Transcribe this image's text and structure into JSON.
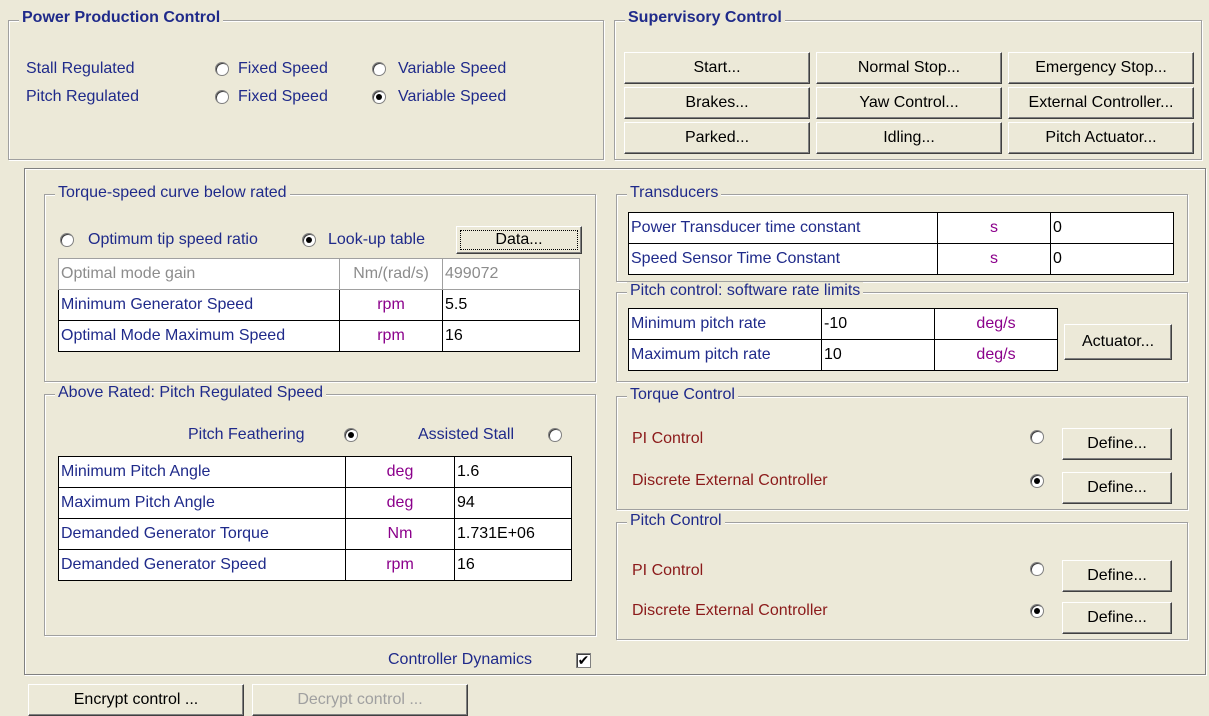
{
  "power_production": {
    "title": "Power Production Control",
    "rows": [
      {
        "label": "Stall Regulated",
        "opt1": "Fixed Speed",
        "opt2": "Variable Speed",
        "selected": "none"
      },
      {
        "label": "Pitch Regulated",
        "opt1": "Fixed Speed",
        "opt2": "Variable Speed",
        "selected": "opt2"
      }
    ]
  },
  "supervisory": {
    "title": "Supervisory Control",
    "buttons": [
      "Start...",
      "Normal Stop...",
      "Emergency Stop...",
      "Brakes...",
      "Yaw Control...",
      "External Controller...",
      "Parked...",
      "Idling...",
      "Pitch Actuator..."
    ]
  },
  "torque_speed": {
    "title": "Torque-speed curve below rated",
    "opt_tsr": "Optimum tip speed ratio",
    "opt_lookup": "Look-up table",
    "selected": "lookup",
    "data_button": "Data...",
    "rows": [
      {
        "name": "Optimal mode gain",
        "unit": "Nm/(rad/s)",
        "value": "499072",
        "disabled": true
      },
      {
        "name": "Minimum Generator Speed",
        "unit": "rpm",
        "value": "5.5"
      },
      {
        "name": "Optimal Mode Maximum Speed",
        "unit": "rpm",
        "value": "16"
      }
    ]
  },
  "above_rated": {
    "title": "Above Rated: Pitch Regulated Speed",
    "opt_feather": "Pitch Feathering",
    "opt_stall": "Assisted Stall",
    "selected": "feather",
    "rows": [
      {
        "name": "Minimum Pitch Angle",
        "unit": "deg",
        "value": "1.6"
      },
      {
        "name": "Maximum Pitch Angle",
        "unit": "deg",
        "value": "94"
      },
      {
        "name": "Demanded Generator Torque",
        "unit": "Nm",
        "value": "1.731E+06"
      },
      {
        "name": "Demanded Generator Speed",
        "unit": "rpm",
        "value": "16"
      }
    ]
  },
  "transducers": {
    "title": "Transducers",
    "rows": [
      {
        "name": "Power Transducer time constant",
        "unit": "s",
        "value": "0"
      },
      {
        "name": "Speed Sensor Time Constant",
        "unit": "s",
        "value": "0"
      }
    ]
  },
  "pitch_rate": {
    "title": "Pitch control: software rate limits",
    "rows": [
      {
        "name": "Minimum pitch rate",
        "value": "-10",
        "unit": "deg/s"
      },
      {
        "name": "Maximum pitch rate",
        "value": "10",
        "unit": "deg/s"
      }
    ],
    "actuator_button": "Actuator..."
  },
  "torque_control": {
    "title": "Torque Control",
    "pi_label": "PI Control",
    "ext_label": "Discrete External Controller",
    "selected": "ext",
    "define_label": "Define..."
  },
  "pitch_control": {
    "title": "Pitch Control",
    "pi_label": "PI Control",
    "ext_label": "Discrete External Controller",
    "selected": "ext",
    "define_label": "Define..."
  },
  "controller_dynamics": {
    "label": "Controller Dynamics",
    "checked": true,
    "check_glyph": "✔"
  },
  "footer": {
    "encrypt": "Encrypt control ...",
    "decrypt": "Decrypt control ..."
  }
}
